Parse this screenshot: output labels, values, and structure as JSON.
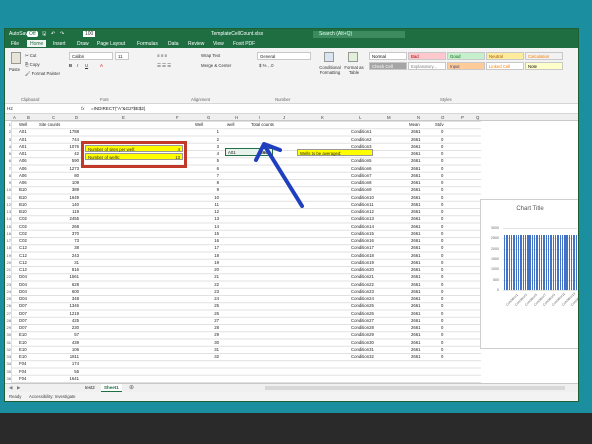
{
  "window": {
    "qat_autosave": "AutoSave",
    "qat_toggle": "Off",
    "zoom": "100",
    "file_name": "TemplateCellCount.xlsx",
    "search_placeholder": "Search (Alt+Q)"
  },
  "menu": [
    "File",
    "Home",
    "Insert",
    "Draw",
    "Page Layout",
    "Formulas",
    "Data",
    "Review",
    "View",
    "Foxit PDF"
  ],
  "ribbon": {
    "clipboard": {
      "paste": "Paste",
      "cut": "Cut",
      "copy": "Copy",
      "format_painter": "Format Painter",
      "label": "Clipboard"
    },
    "font": {
      "name": "Calibri",
      "size": "11",
      "label": "Font"
    },
    "alignment": {
      "wrap": "Wrap Text",
      "merge": "Merge & Center",
      "label": "Alignment"
    },
    "number": {
      "format": "General",
      "label": "Number"
    },
    "styles": {
      "conditional": "Conditional Formatting",
      "format_table": "Format as Table",
      "label": "Styles",
      "cells": [
        {
          "text": "Normal",
          "bg": "#ffffff",
          "fg": "#000000"
        },
        {
          "text": "Bad",
          "bg": "#ffc7ce",
          "fg": "#9c0006"
        },
        {
          "text": "Good",
          "bg": "#c6efce",
          "fg": "#006100"
        },
        {
          "text": "Neutral",
          "bg": "#ffeb9c",
          "fg": "#9c5700"
        },
        {
          "text": "Calculation",
          "bg": "#f2f2f2",
          "fg": "#fa7d00"
        },
        {
          "text": "Check Cell",
          "bg": "#a5a5a5",
          "fg": "#ffffff"
        },
        {
          "text": "Explanatory...",
          "bg": "#ffffff",
          "fg": "#7f7f7f"
        },
        {
          "text": "Input",
          "bg": "#ffcc99",
          "fg": "#3f3f76"
        },
        {
          "text": "Linked Cell",
          "bg": "#ffffff",
          "fg": "#fa7d00"
        },
        {
          "text": "Note",
          "bg": "#ffffcc",
          "fg": "#000000"
        }
      ]
    }
  },
  "formula_bar": {
    "name_box": "H2",
    "fx": "fx",
    "formula": "=INDIRECT(\"A\"&G2*$E$2)"
  },
  "columns": [
    "A",
    "B",
    "C",
    "D",
    "E",
    "F",
    "G",
    "H",
    "I",
    "J",
    "K",
    "L",
    "M",
    "N",
    "O",
    "P",
    "Q"
  ],
  "col_a_header": "Well",
  "col_b_header": "Site counts",
  "wells": [
    "A01",
    "A01",
    "A01",
    "A01",
    "A06",
    "A06",
    "A06",
    "A06",
    "B10",
    "B10",
    "B10",
    "B10",
    "C02",
    "C02",
    "C02",
    "C02",
    "C12",
    "C12",
    "C12",
    "C12",
    "D04",
    "D04",
    "D04",
    "D04",
    "D07",
    "D07",
    "D07",
    "D07",
    "E10",
    "E10",
    "E10",
    "E10",
    "F04",
    "F04",
    "F04"
  ],
  "site_counts": [
    "1788",
    "744",
    "1076",
    "42",
    "590",
    "1273",
    "80",
    "109",
    "389",
    "1649",
    "140",
    "119",
    "2455",
    "268",
    "370",
    "73",
    "38",
    "243",
    "31",
    "816",
    "1561",
    "628",
    "600",
    "348",
    "1346",
    "1219",
    "425",
    "230",
    "57",
    "439",
    "106",
    "1811",
    "174",
    "55",
    "1641"
  ],
  "params": {
    "sites_label": "Number of sites per well:",
    "sites_value": "4",
    "wells_label": "Number of wells:",
    "wells_value": "13"
  },
  "g_header": "Well",
  "h_header": "well",
  "i_header": "Total counts",
  "h2_value": "A01",
  "i2_value": "2661",
  "g_numbers": [
    "1",
    "2",
    "3",
    "4",
    "5",
    "6",
    "7",
    "8",
    "9",
    "10",
    "11",
    "12",
    "13",
    "14",
    "15",
    "16",
    "17",
    "18",
    "19",
    "20",
    "21",
    "22",
    "23",
    "24",
    "25",
    "26",
    "27",
    "28",
    "29",
    "30",
    "31",
    "32"
  ],
  "avg_label": "Wells to be averaged:",
  "m_header_mean": "Mean",
  "n_header_stdv": "Stdv",
  "conditions": [
    "Condition1",
    "Condition2",
    "Condition3",
    "Condition4",
    "Condition5",
    "Condition6",
    "Condition7",
    "Condition8",
    "Condition9",
    "Condition10",
    "Condition11",
    "Condition12",
    "Condition13",
    "Condition14",
    "Condition15",
    "Condition16",
    "Condition17",
    "Condition18",
    "Condition19",
    "Condition20",
    "Condition21",
    "Condition22",
    "Condition23",
    "Condition24",
    "Condition25",
    "Condition26",
    "Condition27",
    "Condition28",
    "Condition29",
    "Condition30",
    "Condition31",
    "Condition32"
  ],
  "mean_value": "2661",
  "stdv_value": "0",
  "chart": {
    "title": "Chart Title",
    "y_ticks": [
      "3000",
      "2500",
      "2000",
      "1500",
      "1000",
      "500",
      "0"
    ],
    "x_labels": [
      "Condition1",
      "Condition3",
      "Condition5",
      "Condition7",
      "Condition9",
      "Condition11",
      "Condition13",
      "Condition15"
    ]
  },
  "chart_data": {
    "type": "bar",
    "title": "Chart Title",
    "categories": [
      "Condition1",
      "Condition2",
      "Condition3",
      "Condition4",
      "Condition5",
      "Condition6",
      "Condition7",
      "Condition8",
      "Condition9",
      "Condition10",
      "Condition11",
      "Condition12",
      "Condition13",
      "Condition14",
      "Condition15",
      "Condition16",
      "Condition17",
      "Condition18",
      "Condition19",
      "Condition20",
      "Condition21",
      "Condition22",
      "Condition23",
      "Condition24",
      "Condition25",
      "Condition26",
      "Condition27",
      "Condition28",
      "Condition29",
      "Condition30",
      "Condition31",
      "Condition32"
    ],
    "values": [
      2661,
      2661,
      2661,
      2661,
      2661,
      2661,
      2661,
      2661,
      2661,
      2661,
      2661,
      2661,
      2661,
      2661,
      2661,
      2661,
      2661,
      2661,
      2661,
      2661,
      2661,
      2661,
      2661,
      2661,
      2661,
      2661,
      2661,
      2661,
      2661,
      2661,
      2661,
      2661
    ],
    "ylim": [
      0,
      3000
    ]
  },
  "sheets": [
    "test2",
    "Sheet1"
  ],
  "status": {
    "ready": "Ready",
    "accessibility": "Accessibility: Investigate"
  },
  "colors": {
    "excel_green": "#1e6e42",
    "highlight_yellow": "#ffff00",
    "annotation_red": "#c0392b",
    "annotation_arrow": "#1f3fbf",
    "bar_blue": "#4472c4"
  }
}
